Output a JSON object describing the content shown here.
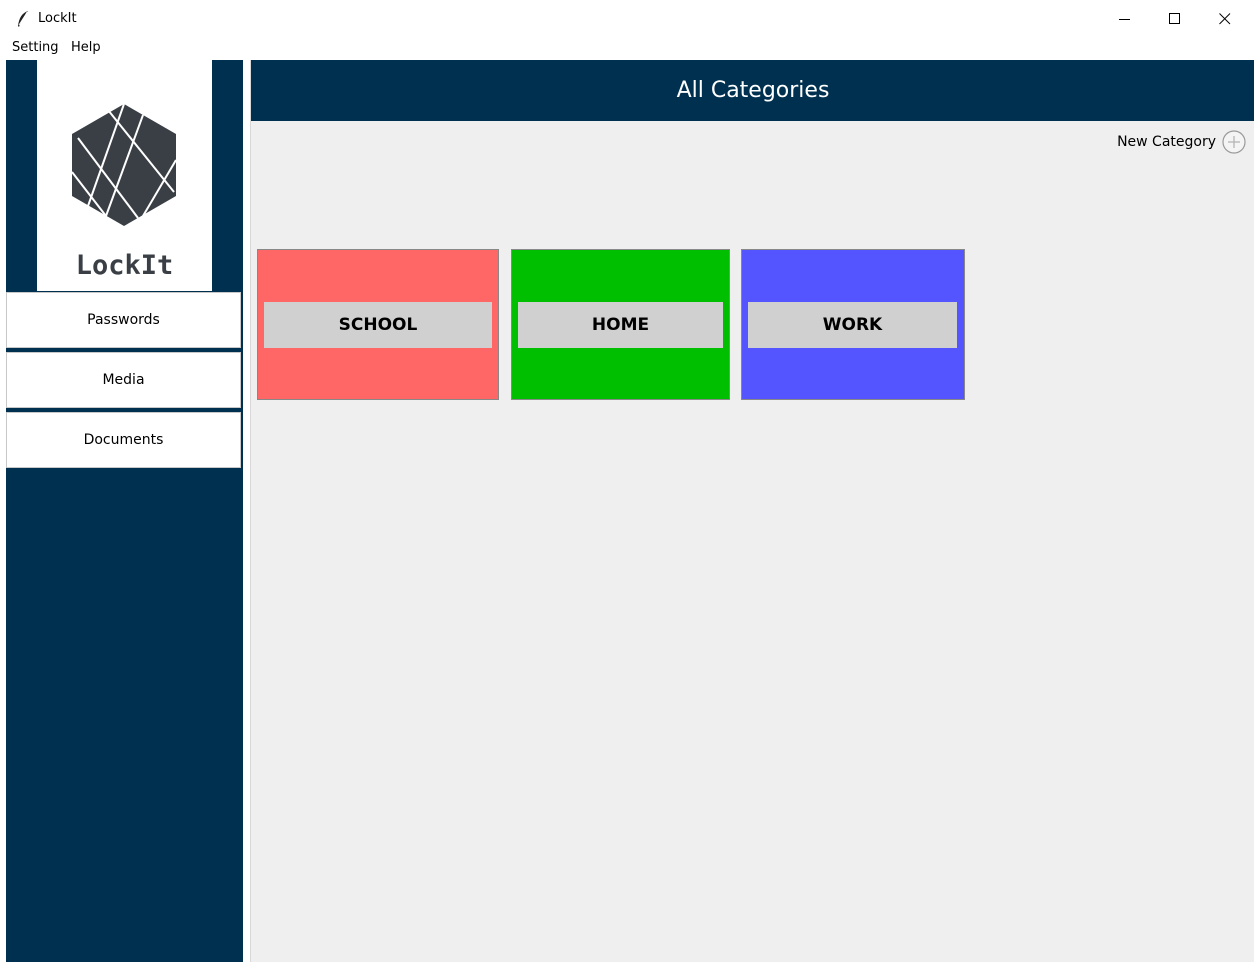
{
  "window": {
    "title": "LockIt",
    "icon": "feather-icon",
    "controls": [
      "minimize-icon",
      "maximize-icon",
      "close-icon"
    ]
  },
  "menu": {
    "items": [
      {
        "label": "Setting"
      },
      {
        "label": "Help"
      }
    ]
  },
  "sidebar": {
    "logo_text": "LockIt",
    "nav": [
      {
        "label": "Passwords"
      },
      {
        "label": "Media"
      },
      {
        "label": "Documents"
      }
    ]
  },
  "main": {
    "header_title": "All Categories",
    "new_category_label": "New Category",
    "new_category_icon": "plus-circle-icon",
    "categories": [
      {
        "label": "SCHOOL",
        "color": "#ff6666"
      },
      {
        "label": "HOME",
        "color": "#00bf00"
      },
      {
        "label": "WORK",
        "color": "#5555ff"
      }
    ]
  },
  "colors": {
    "brand_navy": "#00304f",
    "content_bg": "#efefef",
    "card_button": "#d0d0d0"
  }
}
